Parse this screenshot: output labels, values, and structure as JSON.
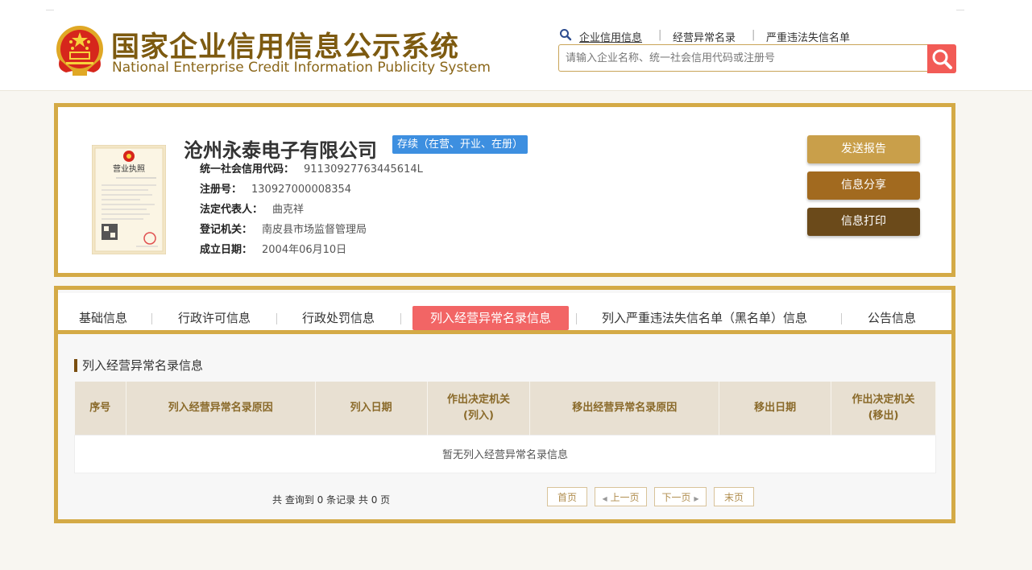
{
  "header": {
    "title_cn": "国家企业信用信息公示系统",
    "title_en": "National Enterprise Credit Information Publicity System",
    "links": [
      {
        "label": "企业信用信息",
        "active": true
      },
      {
        "label": "经营异常名录",
        "active": false
      },
      {
        "label": "严重违法失信名单",
        "active": false
      }
    ],
    "search_placeholder": "请输入企业名称、统一社会信用代码或注册号"
  },
  "company": {
    "name": "沧州永泰电子有限公司",
    "status": "存续（在营、开业、在册）",
    "fields": [
      {
        "label": "统一社会信用代码：",
        "value": "91130927763445614L"
      },
      {
        "label": "注册号：",
        "value": "130927000008354"
      },
      {
        "label": "法定代表人：",
        "value": "曲克祥"
      },
      {
        "label": "登记机关：",
        "value": "南皮县市场监督管理局"
      },
      {
        "label": "成立日期：",
        "value": "2004年06月10日"
      }
    ],
    "license_text": "营业执照"
  },
  "actions": {
    "send_report": "发送报告",
    "share": "信息分享",
    "print": "信息打印"
  },
  "tabs": [
    {
      "label": "基础信息",
      "active": false
    },
    {
      "label": "行政许可信息",
      "active": false
    },
    {
      "label": "行政处罚信息",
      "active": false
    },
    {
      "label": "列入经营异常名录信息",
      "active": true
    },
    {
      "label": "列入严重违法失信名单（黑名单）信息",
      "active": false
    },
    {
      "label": "公告信息",
      "active": false
    }
  ],
  "section": {
    "title": "列入经营异常名录信息",
    "columns": [
      "序号",
      "列入经营异常名录原因",
      "列入日期",
      "作出决定机关\n(列入)",
      "移出经营异常名录原因",
      "移出日期",
      "作出决定机关\n(移出)"
    ],
    "empty_text": "暂无列入经营异常名录信息"
  },
  "pager": {
    "info": "共 查询到 0 条记录 共 0 页",
    "first": "首页",
    "prev": "上一页",
    "next": "下一页",
    "last": "末页"
  },
  "colors": {
    "gold_border": "#d4aa46",
    "btn_report": "#c99f4a",
    "btn_share": "#a26a1f",
    "btn_print": "#6b4a1a",
    "tab_active": "#f26565",
    "badge": "#3d8fe0",
    "search_btn": "#f25b56"
  }
}
